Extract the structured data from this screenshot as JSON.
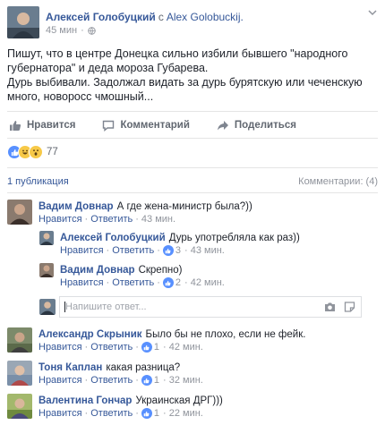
{
  "post": {
    "author": "Алексей Голобуцкий",
    "with_sep": "с",
    "with_name": "Alex Golobuckij.",
    "time": "45 мин",
    "dot": "·",
    "text": [
      "Пишут, что в центре Донецка сильно избили бывшего \"народного губернатора\" и деда мороза Губарева.",
      "Дурь выбивали. Задолжал видать за дурь бурятскую или чеченскую много, новоросс чмошный..."
    ]
  },
  "actions": {
    "like": "Нравится",
    "comment": "Комментарий",
    "share": "Поделиться"
  },
  "reactions": {
    "count": "77"
  },
  "stats": {
    "shares": "1 публикация",
    "comments": "Комментарии: (4)"
  },
  "comments": [
    {
      "name": "Вадим Довнар",
      "text": "А где жена-министр была?))",
      "like": "Нравится",
      "reply": "Ответить",
      "time": "43 мин."
    },
    {
      "name": "Алексей Голобуцкий",
      "text": "Дурь употребляла как раз))",
      "like": "Нравится",
      "reply": "Ответить",
      "likes": "3",
      "time": "43 мин."
    },
    {
      "name": "Вадим Довнар",
      "text": "Скрепно)",
      "like": "Нравится",
      "reply": "Ответить",
      "time": "42 мин."
    },
    {
      "name": "Вадим Довнар",
      "text": "",
      "like": "Нравится",
      "reply": "Ответить",
      "likes": "2",
      "time": "42 мин."
    },
    {
      "name": "Александр Скрыник",
      "text": "Было бы не плохо, если не фейк.",
      "like": "Нравится",
      "reply": "Ответить",
      "likes": "1",
      "time": "42 мин."
    },
    {
      "name": "Тоня Каплан",
      "text": "какая разница?",
      "like": "Нравится",
      "reply": "Ответить",
      "likes": "1",
      "time": "32 мин."
    },
    {
      "name": "Валентина Гончар",
      "text": "Украинская ДРГ)))",
      "like": "Нравится",
      "reply": "Ответить",
      "likes": "1",
      "time": "22 мин."
    }
  ],
  "reply_input": {
    "placeholder": "Напишите ответ..."
  },
  "meta_sep": "·",
  "icons": {
    "reactions": [
      "like-icon",
      "haha-icon",
      "wow-icon"
    ],
    "input": [
      "camera-icon",
      "sticker-icon"
    ]
  },
  "colors": {
    "link": "#365899",
    "muted": "#90949c",
    "like_blue": "#5890ff",
    "emoji_yellow": "#f7c948"
  }
}
